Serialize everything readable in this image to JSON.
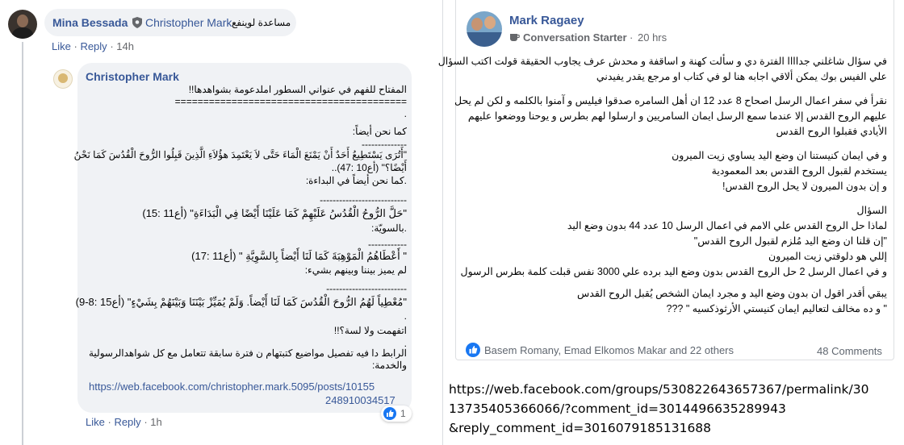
{
  "left": {
    "comment1": {
      "author": "Mina Bessada",
      "replying_to": "Christopher Mark",
      "text": "مساعدة لوينفع",
      "actions": {
        "like": "Like",
        "reply": "Reply",
        "time": "14h"
      }
    },
    "reply": {
      "author": "Christopher Mark",
      "lines": [
        "المفتاح للفهم في عنواني السطور املدعومة بشواهدها!!",
        "=========================================",
        ".",
        "كما نحن أيضاً:",
        "--------------",
        "\"أَتُرَى يَسْتَطِيعُ أَحَدٌ أَنْ يَمْنَعَ الْمَاءَ حَتَّى لاَ يَعْتَمِدَ هؤُلاَءِ الَّذِينَ قَبِلُوا الرُّوحَ الْقُدُسَ كَمَا نَحْنُ",
        "أَيْضًا؟\" (أع10 :47)..",
        ".كما نحن أيضاً في البداءة:",
        "---------------------------",
        "\"حَلَّ الرُّوحُ الْقُدُسُ عَلَيْهِمْ كَمَا عَلَيْنَا أَيْضًا فِي الْبَدَاءَةِ\" (أع11 :15)",
        ".بالسويّة:",
        "------------",
        "\" أَعْطَاهُمُ الْمَوْهِبَةَ كَمَا لَنَا أَيْضاً بِالسَّوِيَّةِ \" (أع11 :17)",
        "لم يميز بيننا وبينهم بشيء:",
        "-------------------------",
        "\"مُعْطِياً لَهُمُ الرُّوحَ الْقُدُسَ كَمَا لَنَا أَيْضاً. وَلَمْ يُمَيِّزْ بَيْنَنَا وَبَيْنَهُمْ بِشَيْءٍ\" (أع15 :8-9)",
        ".",
        "اتفهمت ولا لسة؟!!",
        ".",
        "الرابط دا فيه تفصيل مواضيع كتبتهام ن فترة سابقة تتعامل مع كل شواهدالرسولية",
        "والخدمة:"
      ],
      "link_line1": "https://web.facebook.com/christopher.mark.5095/posts/10155",
      "link_line2": "248910034517",
      "reaction_count": "1",
      "actions": {
        "like": "Like",
        "reply": "Reply",
        "time": "1h"
      }
    }
  },
  "right": {
    "post": {
      "author": "Mark Ragaey",
      "badge": "Conversation Starter",
      "time": "20 hrs",
      "para1": [
        "في سؤال شاغلني جداااا الفترة دي و سألت كهنة و اساقفة و محدش عرف يجاوب الحقيقة قولت اكتب السؤال",
        "علي الفيس بوك يمكن ألاقي اجابه هنا لو في كتاب او مرجع يقدر يفيدني"
      ],
      "para2": [
        "نقرأ في سفر اعمال الرسل اصحاح 8 عدد 12 ان أهل السامره صدقوا فيليس و آمنوا بالكلمه و لكن لم يحل",
        "عليهم الروح القدس إلا عندما سمع الرسل ايمان السامريين و ارسلوا لهم بطرس و يوحنا ووضعوا عليهم",
        "الأيادي فقبلوا الروح القدس"
      ],
      "para3": [
        "و في ايمان كنيستنا ان وضع اليد يساوي زيت الميرون",
        "يستخدم لقبول الروح القدس بعد المعمودية",
        "و إن بدون الميرون لا يحل الروح القدس!"
      ],
      "para4": [
        "السؤال",
        "لماذا حل الروح القدس علي الامم في اعمال الرسل 10 عدد 44 بدون وضع اليد",
        "\"إن قلنا ان وضع اليد مُلزم لقبول الروح القدس\"",
        "إللي هو دلوقتي زيت الميرون",
        "و في اعمال الرسل 2 حل الروح القدس بدون وضع اليد برده علي 3000 نفس قبلت كلمة بطرس الرسول"
      ],
      "para5": [
        "يبقي أقدر اقول ان بدون وضع اليد و مجرد ايمان الشخص يُقبل الروح القدس",
        "\" و ده مخالف لتعاليم ايمان كنيستي الأرثوذكسيه \" ???"
      ],
      "reactions_text": "Basem Romany, Emad Elkomos Makar and 22 others",
      "comments_text": "48 Comments"
    },
    "url_caption": [
      "https://web.facebook.com/groups/530822643657367/permalink/30",
      "13735405366066/?comment_id=3014496635289943",
      "&reply_comment_id=3016079185131688"
    ]
  },
  "colors": {
    "link": "#385898",
    "bubble": "#f0f2f5",
    "like_blue": "#1877f2"
  }
}
